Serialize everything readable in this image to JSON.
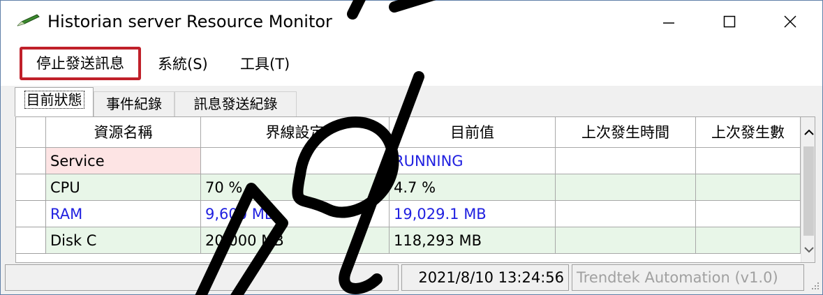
{
  "window": {
    "title": "Historian server Resource Monitor",
    "icon": "green-pen-icon",
    "controls": {
      "minimize": "minimize-icon",
      "maximize": "maximize-icon",
      "close": "close-icon"
    }
  },
  "menu": {
    "stop_messages": "停止發送訊息",
    "system": "系統(S)",
    "tools": "工具(T)",
    "highlight_color": "#c0202a"
  },
  "tabs": [
    "目前狀態",
    "事件紀錄",
    "訊息發送紀錄"
  ],
  "grid": {
    "headers": [
      "資源名稱",
      "界線設定",
      "目前值",
      "上次發生時間",
      "上次發生數"
    ],
    "rows": [
      {
        "name": "Service",
        "limit": "",
        "current": "RUNNING",
        "last_time": "",
        "last_count": "",
        "style": "service"
      },
      {
        "name": "CPU",
        "limit": "70 %",
        "current": "4.7 %",
        "last_time": "",
        "last_count": "",
        "style": "ok"
      },
      {
        "name": "RAM",
        "limit": "9,600 MB",
        "current": "19,029.1 MB",
        "last_time": "",
        "last_count": "",
        "style": "alert"
      },
      {
        "name": "Disk C",
        "limit": "20,000 MB",
        "current": "118,293 MB",
        "last_time": "",
        "last_count": "",
        "style": "ok"
      }
    ],
    "colors": {
      "service_bg": "#fde4e4",
      "ok_bg": "#e8f6e8",
      "alert_text": "#2020e0",
      "running_text": "#2020e0"
    }
  },
  "status": {
    "timestamp": "2021/8/10 13:24:56",
    "company": "Trendtek Automation (v1.0)"
  }
}
